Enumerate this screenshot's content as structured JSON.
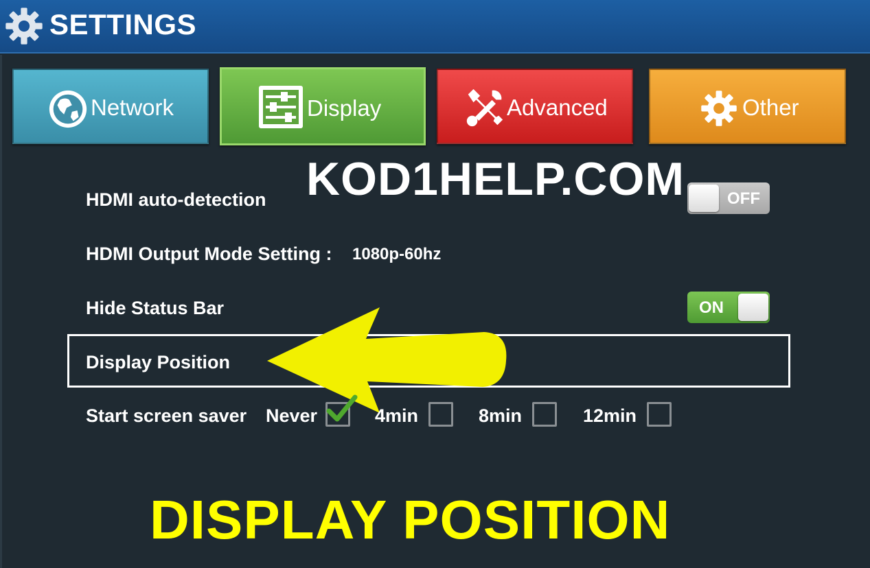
{
  "header": {
    "title": "SETTINGS",
    "icon": "gear-icon"
  },
  "tabs": [
    {
      "label": "Network",
      "icon": "globe-icon",
      "color": "#4aa6c0"
    },
    {
      "label": "Display",
      "icon": "sliders-icon",
      "color": "#67b445",
      "selected": true
    },
    {
      "label": "Advanced",
      "icon": "tools-icon",
      "color": "#e03434"
    },
    {
      "label": "Other",
      "icon": "gear-icon",
      "color": "#f09d2c"
    }
  ],
  "watermark": "KOD1HELP.COM",
  "settings": {
    "hdmi_auto_detection": {
      "label": "HDMI auto-detection",
      "toggle": "OFF"
    },
    "hdmi_output_mode": {
      "label": "HDMI Output Mode Setting :",
      "value": "1080p-60hz"
    },
    "hide_status_bar": {
      "label": "Hide Status Bar",
      "toggle": "ON"
    },
    "display_position": {
      "label": "Display Position"
    },
    "screen_saver": {
      "label": "Start screen saver",
      "options": [
        {
          "label": "Never",
          "checked": true
        },
        {
          "label": "4min",
          "checked": false
        },
        {
          "label": "8min",
          "checked": false
        },
        {
          "label": "12min",
          "checked": false
        }
      ]
    }
  },
  "caption": "DISPLAY POSITION",
  "colors": {
    "titlebar": "#1a559a",
    "background": "#1f2a32",
    "accent_yellow": "#ffff00",
    "arrow": "#f2f000"
  }
}
